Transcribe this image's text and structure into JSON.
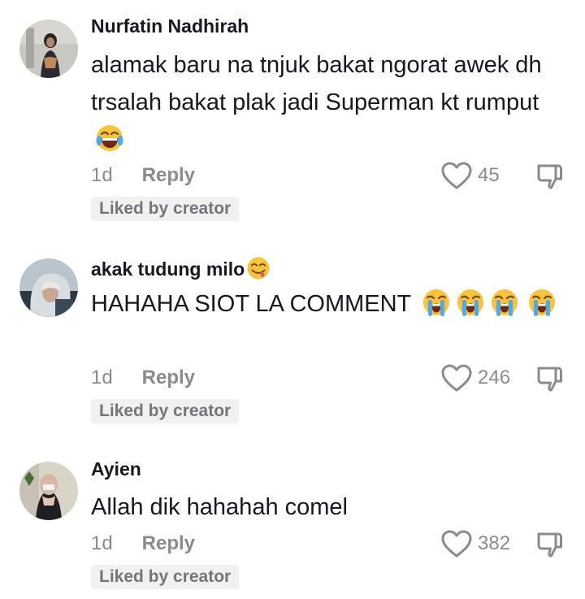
{
  "comments": [
    {
      "username": "Nurfatin Nadhirah",
      "text": "alamak baru na tnjuk bakat ngorat awek dh trsalah bakat plak jadi Superman kt rumput",
      "emoji_after_text": "😂",
      "time": "1d",
      "reply_label": "Reply",
      "likes": "45",
      "badge": "Liked by creator"
    },
    {
      "username": "akak tudung milo",
      "username_emoji": "😋",
      "text": "HAHAHA SIOT LA COMMENT",
      "emoji_after_text": "😭😭😭😭",
      "time": "1d",
      "reply_label": "Reply",
      "likes": "246",
      "badge": "Liked by creator"
    },
    {
      "username": "Ayien",
      "text": "Allah dik hahahah comel",
      "time": "1d",
      "reply_label": "Reply",
      "likes": "382",
      "badge": "Liked by creator"
    }
  ],
  "icons": {
    "like": "heart-outline-icon",
    "dislike": "thumbs-down-outline-icon",
    "laugh": "face-with-tears-of-joy-icon",
    "cry": "loudly-crying-face-icon",
    "yum": "face-savoring-food-icon"
  },
  "colors": {
    "text": "#161823",
    "muted": "#8a8b91",
    "badge_bg": "#f1f1f2",
    "emoji_yellow": "#f9c23c"
  }
}
